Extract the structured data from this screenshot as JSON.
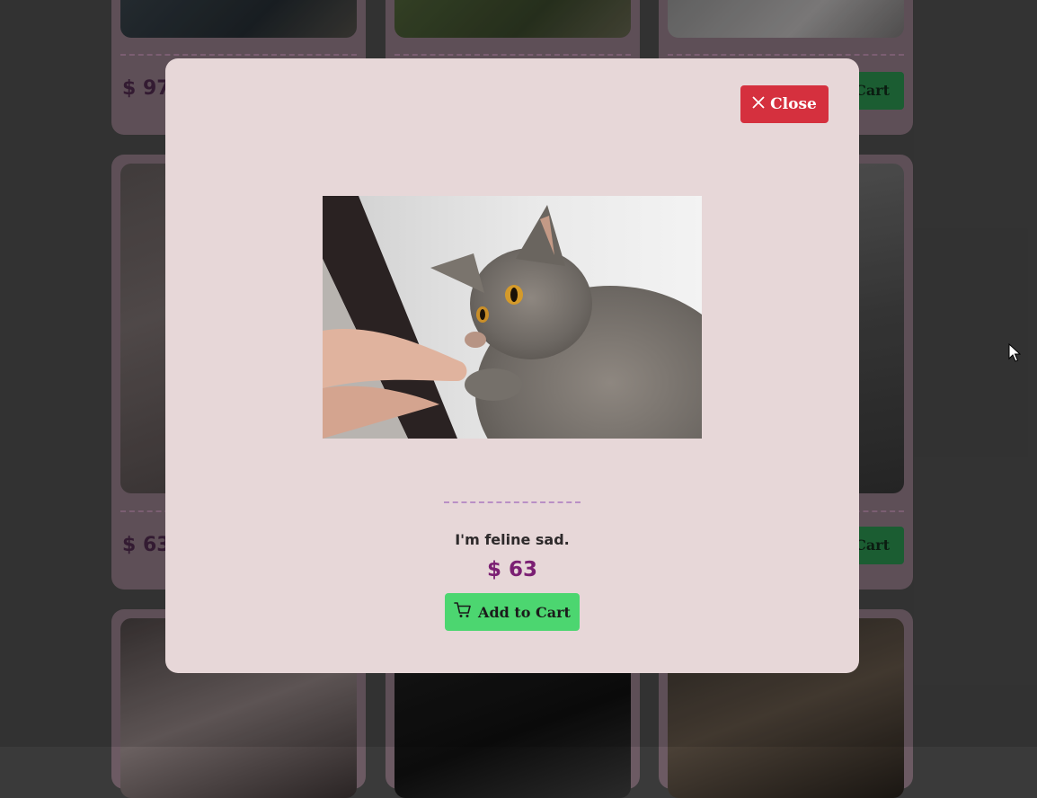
{
  "modal": {
    "close_label": "Close",
    "caption": "I'm feline sad.",
    "price": "$ 63",
    "add_to_cart_label": "Add to Cart"
  },
  "background_cards": {
    "row1_price": "$ 97",
    "row2_price": "$ 63",
    "cart_partial_label": "Cart"
  },
  "icons": {
    "close": "close-icon",
    "cart": "cart-icon",
    "cursor": "mouse-pointer-icon"
  },
  "colors": {
    "close_button": "#d5303e",
    "add_button": "#4cd670",
    "price_text": "#7b1f73",
    "modal_bg": "#e7d7d8"
  }
}
